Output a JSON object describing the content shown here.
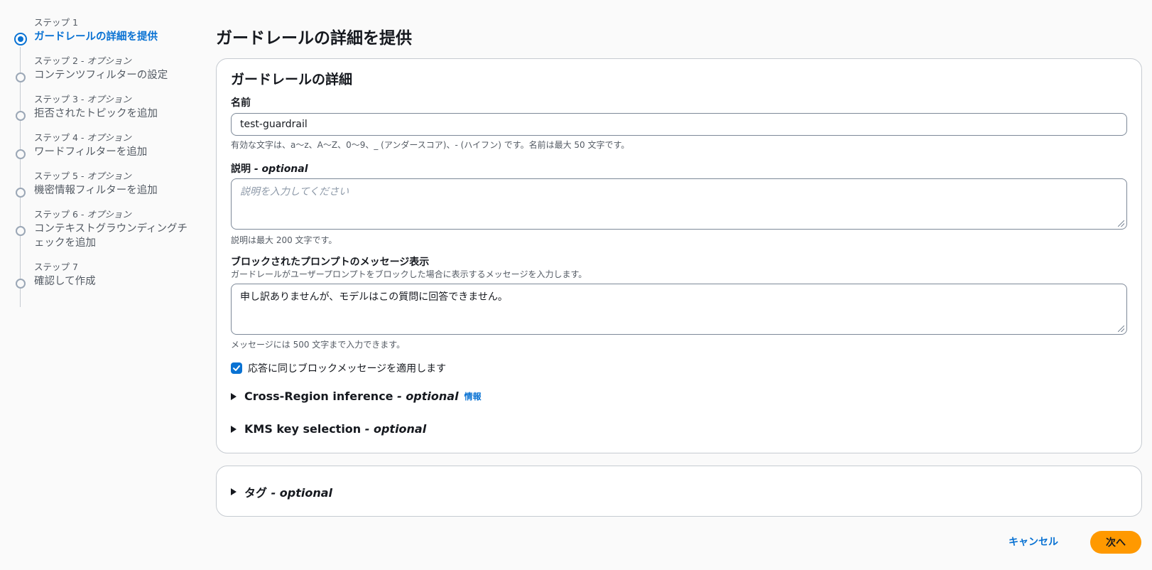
{
  "stepper": {
    "steps": [
      {
        "number": "ステップ 1",
        "optional": "",
        "title": "ガードレールの詳細を提供"
      },
      {
        "number": "ステップ 2",
        "optional": " - オプション",
        "title": "コンテンツフィルターの設定"
      },
      {
        "number": "ステップ 3",
        "optional": " - オプション",
        "title": "拒否されたトピックを追加"
      },
      {
        "number": "ステップ 4",
        "optional": " - オプション",
        "title": "ワードフィルターを追加"
      },
      {
        "number": "ステップ 5",
        "optional": " - オプション",
        "title": "機密情報フィルターを追加"
      },
      {
        "number": "ステップ 6",
        "optional": " - オプション",
        "title": "コンテキストグラウンディングチェックを追加"
      },
      {
        "number": "ステップ 7",
        "optional": "",
        "title": "確認して作成"
      }
    ]
  },
  "page": {
    "title": "ガードレールの詳細を提供"
  },
  "details": {
    "section_title": "ガードレールの詳細",
    "name": {
      "label": "名前",
      "value": "test-guardrail",
      "constraint": "有効な文字は、a〜z、A〜Z、0〜9、_ (アンダースコア)、- (ハイフン) です。名前は最大 50 文字です。"
    },
    "description": {
      "label": "説明",
      "optional": " - optional",
      "placeholder": "説明を入力してください",
      "constraint": "説明は最大 200 文字です。"
    },
    "blocked_prompt": {
      "label": "ブロックされたプロンプトのメッセージ表示",
      "desc": "ガードレールがユーザープロンプトをブロックした場合に表示するメッセージを入力します。",
      "value": "申し訳ありませんが、モデルはこの質問に回答できません。",
      "constraint": "メッセージには 500 文字まで入力できます。"
    },
    "same_message_checkbox": {
      "label": "応答に同じブロックメッセージを適用します",
      "checked": true
    },
    "cross_region": {
      "title": "Cross-Region inference",
      "optional": " - optional",
      "info": "情報"
    },
    "kms": {
      "title": "KMS key selection",
      "optional": " - optional"
    }
  },
  "tags": {
    "title": "タグ",
    "optional": " - optional"
  },
  "footer": {
    "cancel_label": "キャンセル",
    "next_label": "次へ"
  },
  "colors": {
    "accent": "#0972d3",
    "primary_button": "#ff9900"
  }
}
